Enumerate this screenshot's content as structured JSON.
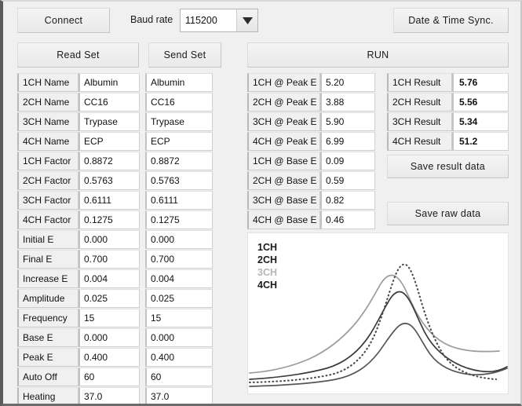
{
  "toolbar": {
    "connect_label": "Connect",
    "baud_rate_label": "Baud rate",
    "baud_rate_value": "115200",
    "baud_dropdown_icon": "chevron-down-icon",
    "date_time_sync_label": "Date  &  Time  Sync."
  },
  "actions": {
    "read_set_label": "Read Set",
    "send_set_label": "Send Set",
    "run_label": "RUN",
    "save_result_label": "Save result data",
    "save_raw_label": "Save raw data"
  },
  "channel_names": {
    "rows": [
      {
        "label": "1CH Name",
        "value": "Albumin",
        "send": "Albumin"
      },
      {
        "label": "2CH Name",
        "value": "CC16",
        "send": "CC16"
      },
      {
        "label": "3CH Name",
        "value": "Trypase",
        "send": "Trypase"
      },
      {
        "label": "4CH Name",
        "value": "ECP",
        "send": "ECP"
      }
    ]
  },
  "channel_factors": {
    "rows": [
      {
        "label": "1CH Factor",
        "value": "0.8872",
        "send": "0.8872"
      },
      {
        "label": "2CH Factor",
        "value": "0.5763",
        "send": "0.5763"
      },
      {
        "label": "3CH Factor",
        "value": "0.6111",
        "send": "0.6111"
      },
      {
        "label": "4CH Factor",
        "value": "0.1275",
        "send": "0.1275"
      }
    ]
  },
  "scan_params": {
    "rows": [
      {
        "label": "Initial E",
        "value": "0.000",
        "send": "0.000"
      },
      {
        "label": "Final E",
        "value": "0.700",
        "send": "0.700"
      },
      {
        "label": "Increase E",
        "value": "0.004",
        "send": "0.004"
      },
      {
        "label": "Amplitude",
        "value": "0.025",
        "send": "0.025"
      },
      {
        "label": "Frequency",
        "value": "15",
        "send": "15"
      },
      {
        "label": "Base E",
        "value": "0.000",
        "send": "0.000"
      },
      {
        "label": "Peak E",
        "value": "0.400",
        "send": "0.400"
      }
    ]
  },
  "device_params": {
    "rows": [
      {
        "label": "Auto Off",
        "value": "60",
        "send": "60"
      },
      {
        "label": "Heating",
        "value": "37.0",
        "send": "37.0"
      }
    ]
  },
  "peak_e": {
    "rows": [
      {
        "label": "1CH @ Peak E",
        "value": "5.20"
      },
      {
        "label": "2CH @ Peak E",
        "value": "3.88"
      },
      {
        "label": "3CH @ Peak E",
        "value": "5.90"
      },
      {
        "label": "4CH @ Peak E",
        "value": "6.99"
      }
    ]
  },
  "base_e": {
    "rows": [
      {
        "label": "1CH @ Base E",
        "value": "0.09"
      },
      {
        "label": "2CH @ Base E",
        "value": "0.59"
      },
      {
        "label": "3CH @ Base E",
        "value": "0.82"
      },
      {
        "label": "4CH @ Base E",
        "value": "0.46"
      }
    ]
  },
  "results": {
    "rows": [
      {
        "label": "1CH Result",
        "value": "5.76"
      },
      {
        "label": "2CH Result",
        "value": "5.56"
      },
      {
        "label": "3CH Result",
        "value": "5.34"
      },
      {
        "label": "4CH Result",
        "value": "51.2"
      }
    ]
  },
  "chart_data": {
    "type": "line",
    "title": "",
    "xlabel": "",
    "ylabel": "",
    "grid": false,
    "legend_position": "top-left",
    "background": "#ffffff",
    "series": [
      {
        "name": "1CH",
        "color": "#4a4a4a",
        "style": "dotted",
        "peak_height": 0.88,
        "baseline": 0.04
      },
      {
        "name": "2CH",
        "color": "#3b3b3b",
        "style": "solid",
        "peak_height": 0.64,
        "baseline": 0.07
      },
      {
        "name": "3CH",
        "color": "#9c9c9c",
        "style": "solid",
        "peak_height": 0.74,
        "baseline": 0.12
      },
      {
        "name": "4CH",
        "color": "#555555",
        "style": "solid",
        "peak_height": 0.48,
        "baseline": 0.02
      }
    ],
    "legend": [
      "1CH",
      "2CH",
      "3CH",
      "4CH"
    ],
    "legend_colors": [
      "#1b1b1b",
      "#1b1b1b",
      "#b6b6b6",
      "#1b1b1b"
    ]
  }
}
